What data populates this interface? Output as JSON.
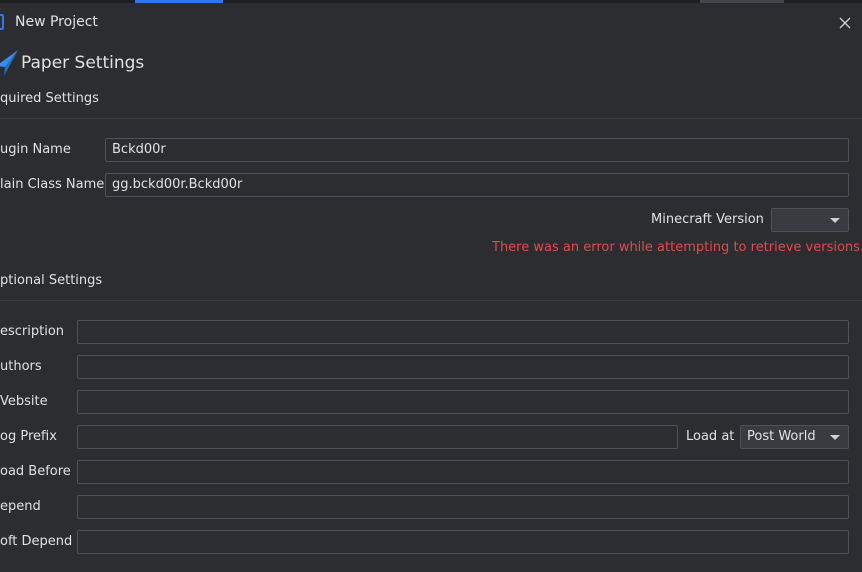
{
  "window": {
    "title": "New Project",
    "header": "Paper Settings"
  },
  "required": {
    "section_title": "quired Settings",
    "plugin_name_label": "ugin Name",
    "plugin_name_value": "Bckd00r",
    "main_class_label": "lain Class Name",
    "main_class_value": "gg.bckd00r.Bckd00r",
    "mc_version_label": "Minecraft Version",
    "mc_version_value": "",
    "error": "There was an error while attempting to retrieve versions."
  },
  "optional": {
    "section_title": "ptional Settings",
    "description_label": "escription",
    "description_value": "",
    "authors_label": "uthors",
    "authors_value": "",
    "website_label": "Vebsite",
    "website_value": "",
    "log_prefix_label": "og Prefix",
    "log_prefix_value": "",
    "load_at_label": "Load at",
    "load_at_value": "Post World",
    "load_before_label": "oad Before",
    "load_before_value": "",
    "depend_label": "epend",
    "depend_value": "",
    "soft_depend_label": "oft Depend",
    "soft_depend_value": ""
  },
  "colors": {
    "accent": "#3574f0",
    "error": "#e5484d",
    "background": "#2b2d30"
  },
  "icons": {
    "title": "project-window-icon",
    "header": "paper-plane-icon",
    "close": "close-icon"
  }
}
